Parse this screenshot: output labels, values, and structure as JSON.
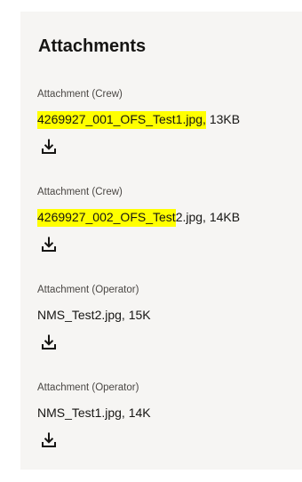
{
  "panel": {
    "title": "Attachments"
  },
  "attachments": [
    {
      "label": "Attachment (Crew)",
      "file_highlighted": "4269927_001_OFS_Test1.jpg,",
      "file_rest": " 13KB",
      "icon": "download-icon"
    },
    {
      "label": "Attachment (Crew)",
      "file_highlighted": "4269927_002_OFS_Test",
      "file_rest": "2.jpg, 14KB",
      "icon": "download-icon"
    },
    {
      "label": "Attachment (Operator)",
      "file_highlighted": "",
      "file_rest": "NMS_Test2.jpg, 15K",
      "icon": "download-icon"
    },
    {
      "label": "Attachment (Operator)",
      "file_highlighted": "",
      "file_rest": "NMS_Test1.jpg, 14K",
      "icon": "download-icon"
    }
  ],
  "colors": {
    "panel_background": "#f6f5f3",
    "text": "#161513",
    "label_text": "#4a4744",
    "highlight": "#ffff00"
  }
}
